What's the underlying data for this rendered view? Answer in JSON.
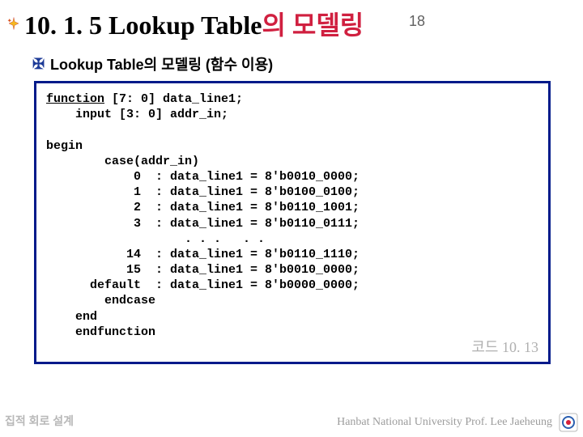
{
  "page": {
    "number": "18",
    "title_prefix": "10. 1. 5 Lookup Table",
    "title_suffix_ko": "의 모델링"
  },
  "subhead": "Lookup Table의 모델링 (함수 이용)",
  "code": {
    "l0a": "function",
    "l0b": " [7: 0] data_line1;",
    "l1": "    input [3: 0] addr_in;",
    "l2": "",
    "l3": "begin",
    "l4": "        case(addr_in)",
    "l5": "            0  : data_line1 = 8'b0010_0000;",
    "l6": "            1  : data_line1 = 8'b0100_0100;",
    "l7": "            2  : data_line1 = 8'b0110_1001;",
    "l8": "            3  : data_line1 = 8'b0110_0111;",
    "l9": "                   . . .   . .",
    "l10": "           14  : data_line1 = 8'b0110_1110;",
    "l11": "           15  : data_line1 = 8'b0010_0000;",
    "l12": "      default  : data_line1 = 8'b0000_0000;",
    "l13": "        endcase",
    "l14": "    end",
    "l15": "    endfunction",
    "label": "코드 10. 13"
  },
  "footer": {
    "left": "집적 회로 설계",
    "right": "Hanbat National University Prof. Lee Jaeheung"
  }
}
